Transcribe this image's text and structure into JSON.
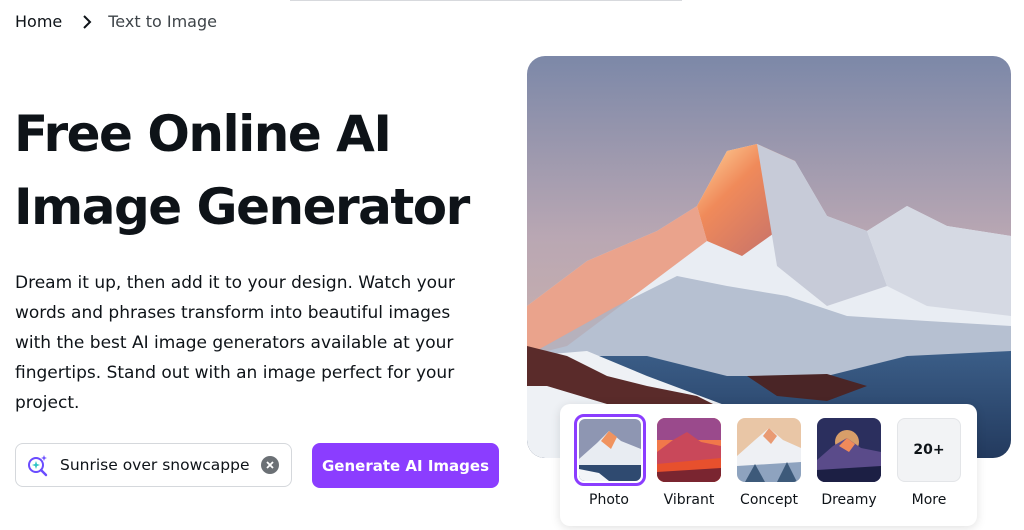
{
  "breadcrumb": {
    "home": "Home",
    "current": "Text to Image"
  },
  "hero": {
    "title_line1": "Free Online AI",
    "title_line2": "Image Generator",
    "description": "Dream it up, then add it to your design. Watch your words and phrases transform into beautiful images with the best AI image generators available at your fingertips. Stand out with an image perfect for your project."
  },
  "prompt": {
    "value": "Sunrise over snowcappe",
    "icon": "sparkle-search-icon",
    "clear_icon": "clear-icon"
  },
  "generate_button": {
    "label": "Generate AI Images"
  },
  "styles": [
    {
      "label": "Photo",
      "selected": true
    },
    {
      "label": "Vibrant",
      "selected": false
    },
    {
      "label": "Concept",
      "selected": false
    },
    {
      "label": "Dreamy",
      "selected": false
    }
  ],
  "more": {
    "count": "20+",
    "label": "More"
  },
  "colors": {
    "accent": "#8b3dff",
    "text": "#0e1318"
  }
}
